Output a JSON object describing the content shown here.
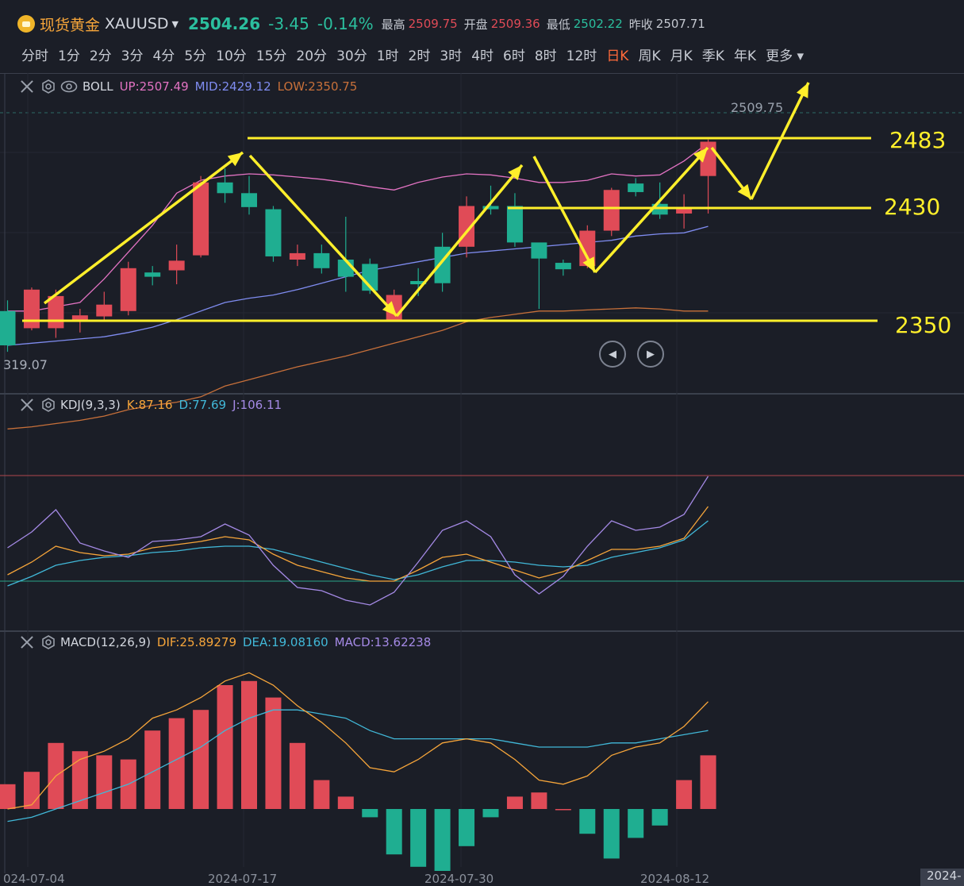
{
  "header": {
    "name": "现货黄金",
    "symbol": "XAUUSD",
    "price": "2504.26",
    "change": "-3.45",
    "change_pct": "-0.14%",
    "high_label": "最高",
    "high": "2509.75",
    "open_label": "开盘",
    "open": "2509.36",
    "low_label": "最低",
    "low": "2502.22",
    "prev_label": "昨收",
    "prev": "2507.71"
  },
  "periods": [
    "分时",
    "1分",
    "2分",
    "3分",
    "4分",
    "5分",
    "10分",
    "15分",
    "20分",
    "30分",
    "1时",
    "2时",
    "3时",
    "4时",
    "6时",
    "8时",
    "12时",
    "日K",
    "周K",
    "月K",
    "季K",
    "年K",
    "更多"
  ],
  "active_period": "日K",
  "boll": {
    "name": "BOLL",
    "up": "UP:2507.49",
    "mid": "MID:2429.12",
    "low": "LOW:2350.75"
  },
  "kdj": {
    "name": "KDJ(9,3,3)",
    "k": "K:87.16",
    "d": "D:77.69",
    "j": "J:106.11"
  },
  "macd": {
    "name": "MACD(12,26,9)",
    "dif": "DIF:25.89279",
    "dea": "DEA:19.08160",
    "macd": "MACD:13.62238"
  },
  "price_tag": "2509.75",
  "low_tag": "319.07",
  "levels": [
    "2483",
    "2430",
    "2350"
  ],
  "dates": [
    "024-07-04",
    "2024-07-17",
    "2024-07-30",
    "2024-08-12",
    "2024-"
  ],
  "colors": {
    "up": "#e04b57",
    "down": "#1fae91",
    "annot": "#ffef2b",
    "boll_up": "#e373c3",
    "boll_mid": "#7f8cf0",
    "boll_low": "#c7703a",
    "k": "#f6a53a",
    "d": "#41b8d8",
    "j": "#a58ae6"
  },
  "chart_data": {
    "type": "candlestick",
    "candles": [
      {
        "o": 2350,
        "c": 2318,
        "h": 2360,
        "l": 2312
      },
      {
        "o": 2334,
        "c": 2370,
        "h": 2372,
        "l": 2332
      },
      {
        "o": 2334,
        "c": 2364,
        "h": 2370,
        "l": 2325
      },
      {
        "o": 2340,
        "c": 2346,
        "h": 2352,
        "l": 2330
      },
      {
        "o": 2345,
        "c": 2356,
        "h": 2368,
        "l": 2340
      },
      {
        "o": 2350,
        "c": 2390,
        "h": 2396,
        "l": 2346
      },
      {
        "o": 2386,
        "c": 2382,
        "h": 2392,
        "l": 2374
      },
      {
        "o": 2388,
        "c": 2397,
        "h": 2412,
        "l": 2375
      },
      {
        "o": 2402,
        "c": 2470,
        "h": 2476,
        "l": 2400
      },
      {
        "o": 2470,
        "c": 2460,
        "h": 2483,
        "l": 2451
      },
      {
        "o": 2460,
        "c": 2447,
        "h": 2476,
        "l": 2440
      },
      {
        "o": 2445,
        "c": 2401,
        "h": 2448,
        "l": 2396
      },
      {
        "o": 2398,
        "c": 2404,
        "h": 2412,
        "l": 2392
      },
      {
        "o": 2404,
        "c": 2390,
        "h": 2412,
        "l": 2385
      },
      {
        "o": 2398,
        "c": 2382,
        "h": 2438,
        "l": 2368
      },
      {
        "o": 2394,
        "c": 2369,
        "h": 2399,
        "l": 2366
      },
      {
        "o": 2340,
        "c": 2365,
        "h": 2370,
        "l": 2340
      },
      {
        "o": 2378,
        "c": 2375,
        "h": 2390,
        "l": 2364
      },
      {
        "o": 2410,
        "c": 2376,
        "h": 2423,
        "l": 2368
      },
      {
        "o": 2410,
        "c": 2448,
        "h": 2457,
        "l": 2400
      },
      {
        "o": 2448,
        "c": 2445,
        "h": 2467,
        "l": 2440
      },
      {
        "o": 2448,
        "c": 2414,
        "h": 2460,
        "l": 2410
      },
      {
        "o": 2414,
        "c": 2399,
        "h": 2412,
        "l": 2352
      },
      {
        "o": 2395,
        "c": 2389,
        "h": 2398,
        "l": 2383
      },
      {
        "o": 2392,
        "c": 2425,
        "h": 2430,
        "l": 2390
      },
      {
        "o": 2425,
        "c": 2463,
        "h": 2465,
        "l": 2420
      },
      {
        "o": 2469,
        "c": 2461,
        "h": 2474,
        "l": 2457
      },
      {
        "o": 2450,
        "c": 2440,
        "h": 2470,
        "l": 2436
      },
      {
        "o": 2441,
        "c": 2446,
        "h": 2459,
        "l": 2427
      },
      {
        "o": 2476,
        "c": 2508,
        "h": 2510,
        "l": 2441
      }
    ],
    "boll_up": [
      2350,
      2350,
      2354,
      2358,
      2380,
      2405,
      2430,
      2460,
      2472,
      2476,
      2478,
      2477,
      2475,
      2473,
      2470,
      2466,
      2463,
      2470,
      2475,
      2478,
      2477,
      2474,
      2470,
      2470,
      2472,
      2478,
      2476,
      2477,
      2490,
      2507
    ],
    "boll_mid": [
      2318,
      2320,
      2322,
      2324,
      2326,
      2330,
      2335,
      2342,
      2350,
      2358,
      2362,
      2365,
      2370,
      2376,
      2382,
      2388,
      2392,
      2396,
      2400,
      2404,
      2406,
      2408,
      2410,
      2412,
      2414,
      2416,
      2420,
      2422,
      2423,
      2429
    ],
    "boll_low": [
      2240,
      2242,
      2245,
      2248,
      2252,
      2258,
      2262,
      2265,
      2270,
      2280,
      2286,
      2292,
      2298,
      2303,
      2308,
      2314,
      2320,
      2326,
      2332,
      2340,
      2344,
      2347,
      2350,
      2350,
      2351,
      2352,
      2353,
      2352,
      2350,
      2350
    ],
    "kdj_k": [
      44,
      52,
      62,
      58,
      56,
      57,
      61,
      63,
      65,
      68,
      66,
      57,
      50,
      46,
      42,
      40,
      40,
      47,
      55,
      57,
      52,
      47,
      42,
      46,
      53,
      60,
      60,
      62,
      67,
      87
    ],
    "kdj_d": [
      37,
      43,
      50,
      53,
      55,
      56,
      58,
      59,
      61,
      62,
      62,
      60,
      56,
      52,
      48,
      44,
      41,
      44,
      49,
      53,
      53,
      52,
      50,
      49,
      50,
      55,
      58,
      61,
      66,
      78
    ],
    "kdj_j": [
      61,
      71,
      85,
      64,
      59,
      55,
      65,
      66,
      68,
      76,
      69,
      50,
      36,
      34,
      28,
      25,
      33,
      52,
      72,
      78,
      68,
      44,
      32,
      43,
      62,
      78,
      72,
      74,
      82,
      106
    ],
    "macd_dif": [
      0,
      1,
      8,
      12,
      14,
      17,
      22,
      24,
      27,
      31,
      33,
      30,
      25,
      21,
      16,
      10,
      9,
      12,
      16,
      17,
      16,
      12,
      7,
      6,
      8,
      13,
      15,
      16,
      20,
      26
    ],
    "macd_dea": [
      -3,
      -2,
      0,
      2,
      4,
      6,
      9,
      12,
      15,
      19,
      22,
      24,
      24,
      23,
      22,
      19,
      17,
      17,
      17,
      17,
      17,
      16,
      15,
      15,
      15,
      16,
      16,
      17,
      18,
      19
    ],
    "macd_hist": [
      6,
      9,
      16,
      14,
      13,
      12,
      19,
      22,
      24,
      30,
      31,
      27,
      16,
      7,
      3,
      -2,
      -11,
      -14,
      -15,
      -9,
      -2,
      3,
      4,
      0,
      -6,
      -12,
      -7,
      -4,
      7,
      13
    ]
  }
}
